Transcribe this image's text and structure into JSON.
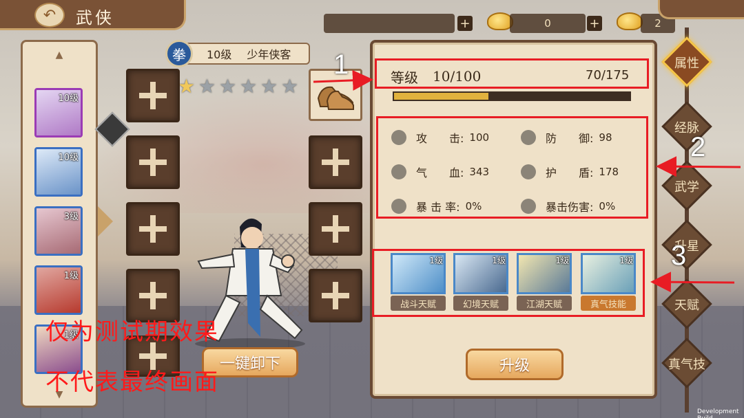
{
  "header": {
    "title": "武侠"
  },
  "resources": [
    {
      "value": "",
      "plus": "+"
    },
    {
      "value": "0",
      "plus": "+"
    },
    {
      "value": "2",
      "plus": ""
    }
  ],
  "hero_list": [
    {
      "level": "10级"
    },
    {
      "level": "10级"
    },
    {
      "level": "3级"
    },
    {
      "level": "1级"
    },
    {
      "level": "1级"
    }
  ],
  "hero": {
    "class_icon": "拳",
    "level": "10级",
    "name": "少年侠客",
    "stars_total": 6,
    "stars_filled": 1,
    "star_glyph": "★"
  },
  "equipment": {
    "unequip_label": "一键卸下"
  },
  "overlay_text": {
    "line1": "仅为测试期效果",
    "line2": "不代表最终画面"
  },
  "attributes": {
    "level_label": "等级",
    "level_value": "10/100",
    "exp_value": "70/175",
    "exp_fraction": 0.4,
    "stats": [
      {
        "icon": "sword-icon",
        "name": "攻　　击:",
        "value": "100"
      },
      {
        "icon": "shield-round-icon",
        "name": "防　　御:",
        "value": "98"
      },
      {
        "icon": "heart-icon",
        "name": "气　　血:",
        "value": "343"
      },
      {
        "icon": "armor-icon",
        "name": "护　　盾:",
        "value": "178"
      },
      {
        "icon": "crit-icon",
        "name": "暴 击 率:",
        "value": "0%"
      },
      {
        "icon": "crit-damage-icon",
        "name": "暴击伤害:",
        "value": "0%"
      }
    ],
    "talents": [
      {
        "level": "1级",
        "name": "战斗天赋"
      },
      {
        "level": "1级",
        "name": "幻境天赋"
      },
      {
        "level": "1级",
        "name": "江湖天赋"
      },
      {
        "level": "1级",
        "name": "真气技能"
      }
    ],
    "upgrade_label": "升级"
  },
  "right_tabs": [
    "属性",
    "经脉",
    "武学",
    "升星",
    "天赋",
    "真气技"
  ],
  "annotations": [
    "1",
    "2",
    "3"
  ],
  "footer": {
    "dev_build": "Development Build"
  },
  "colors": {
    "annotation_red": "#e81c24",
    "exp_fill": "#e1b23e",
    "active_tab_border": "#f6c648"
  }
}
